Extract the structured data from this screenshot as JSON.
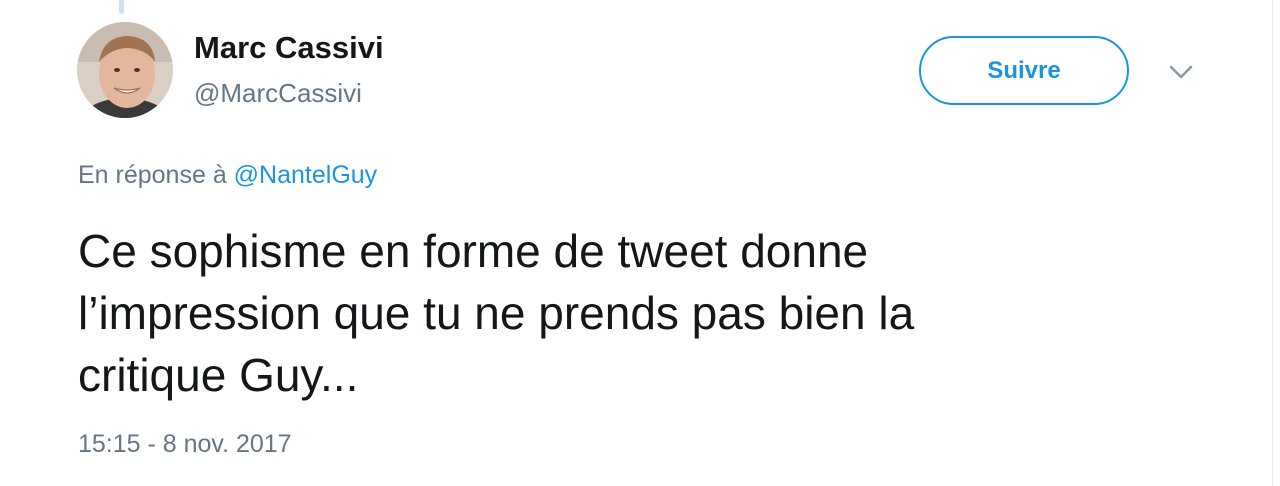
{
  "user": {
    "display_name": "Marc Cassivi",
    "handle": "@MarcCassivi"
  },
  "follow_button": {
    "label": "Suivre"
  },
  "menu_icon": "chevron-down-icon",
  "reply_context": {
    "prefix": "En réponse à",
    "mention": "@NantelGuy"
  },
  "tweet": {
    "lines": [
      "Ce sophisme en forme de tweet donne",
      "l’impression que tu ne prends pas bien la",
      "critique Guy..."
    ]
  },
  "timestamp": "15:15 - 8 nov. 2017",
  "colors": {
    "accent": "#1b95e0",
    "text": "#14171a",
    "secondary_text": "#657786"
  }
}
